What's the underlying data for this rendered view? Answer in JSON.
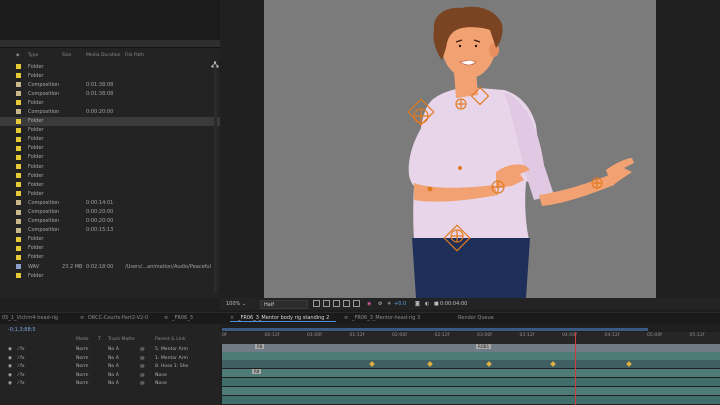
{
  "project": {
    "columns": [
      "Type",
      "Size",
      "Media Duration",
      "File Path"
    ],
    "rows": [
      {
        "type": "Folder",
        "color": "#e8c93a",
        "size": "",
        "duration": "",
        "path": ""
      },
      {
        "type": "Folder",
        "color": "#e8c93a",
        "size": "",
        "duration": "",
        "path": ""
      },
      {
        "type": "Composition",
        "color": "#c6b88a",
        "size": "",
        "duration": "0:01:38:08",
        "path": ""
      },
      {
        "type": "Composition",
        "color": "#c6b88a",
        "size": "",
        "duration": "0:01:38:08",
        "path": ""
      },
      {
        "type": "Folder",
        "color": "#e8c93a",
        "size": "",
        "duration": "",
        "path": ""
      },
      {
        "type": "Composition",
        "color": "#c6b88a",
        "size": "",
        "duration": "0:00:20:00",
        "path": ""
      },
      {
        "type": "Folder",
        "color": "#e8c93a",
        "size": "",
        "duration": "",
        "path": ""
      },
      {
        "type": "Folder",
        "color": "#e8c93a",
        "size": "",
        "duration": "",
        "path": ""
      },
      {
        "type": "Folder",
        "color": "#e8c93a",
        "size": "",
        "duration": "",
        "path": ""
      },
      {
        "type": "Folder",
        "color": "#e8c93a",
        "size": "",
        "duration": "",
        "path": ""
      },
      {
        "type": "Folder",
        "color": "#e8c93a",
        "size": "",
        "duration": "",
        "path": ""
      },
      {
        "type": "Folder",
        "color": "#e8c93a",
        "size": "",
        "duration": "",
        "path": ""
      },
      {
        "type": "Folder",
        "color": "#e8c93a",
        "size": "",
        "duration": "",
        "path": ""
      },
      {
        "type": "Folder",
        "color": "#e8c93a",
        "size": "",
        "duration": "",
        "path": ""
      },
      {
        "type": "Folder",
        "color": "#e8c93a",
        "size": "",
        "duration": "",
        "path": ""
      },
      {
        "type": "Composition",
        "color": "#c6b88a",
        "size": "",
        "duration": "0:00:14:01",
        "path": ""
      },
      {
        "type": "Composition",
        "color": "#c6b88a",
        "size": "",
        "duration": "0:00:20:00",
        "path": ""
      },
      {
        "type": "Composition",
        "color": "#c6b88a",
        "size": "",
        "duration": "0:00:20:00",
        "path": ""
      },
      {
        "type": "Composition",
        "color": "#c6b88a",
        "size": "",
        "duration": "0:00:15:13",
        "path": ""
      },
      {
        "type": "Folder",
        "color": "#e8c93a",
        "size": "",
        "duration": "",
        "path": ""
      },
      {
        "type": "Folder",
        "color": "#e8c93a",
        "size": "",
        "duration": "",
        "path": ""
      },
      {
        "type": "Folder",
        "color": "#e8c93a",
        "size": "",
        "duration": "",
        "path": ""
      },
      {
        "type": "WAV",
        "color": "#8e9ecf",
        "size": "23.2 MB",
        "duration": "0:02:18:00",
        "path": "/Users/...animation/Audio/Peaceful"
      },
      {
        "type": "Folder",
        "color": "#e8c93a",
        "size": "",
        "duration": "",
        "path": ""
      }
    ],
    "selected_index": 6
  },
  "viewer_bar": {
    "zoom": "100%",
    "resolution": "Half",
    "exposure": "+0.0",
    "timecode": "0:00:04:00"
  },
  "tabs": [
    {
      "label": "05_1_Victim4-head-rig",
      "active": false
    },
    {
      "label": "DRCC-Courts-Part2-V2-0",
      "active": false
    },
    {
      "label": "_FR06_3",
      "active": false
    },
    {
      "label": "_FR06_3_Mentor body rig standing 2",
      "active": true
    },
    {
      "label": "_FR06_3_Mentor-head-rig 3",
      "active": false
    },
    {
      "label": "Render Queue",
      "active": false
    }
  ],
  "timeline": {
    "current_time": "-0;1,3;88;5",
    "headers": {
      "mode": "Mode",
      "t": "T",
      "trkmat": "Track Matte",
      "parent": "Parent & Link"
    },
    "layers": [
      {
        "mode": "Norm",
        "trkmat": "No A",
        "parent": "5. Mentor Arm"
      },
      {
        "mode": "Norm",
        "trkmat": "No A",
        "parent": "1. Mentor Arm"
      },
      {
        "mode": "Norm",
        "trkmat": "No A",
        "parent": "8. Hose 1: She"
      },
      {
        "mode": "Norm",
        "trkmat": "No A",
        "parent": "None"
      },
      {
        "mode": "Norm",
        "trkmat": "No A",
        "parent": "None"
      }
    ],
    "ruler_labels": [
      "0f",
      "00:12f",
      "01:00f",
      "01:12f",
      "02:00f",
      "02:12f",
      "03:00f",
      "03:12f",
      "04:00f",
      "04:12f",
      "05:00f",
      "05:12f"
    ],
    "markers": [
      "R8",
      "ROB1"
    ]
  }
}
